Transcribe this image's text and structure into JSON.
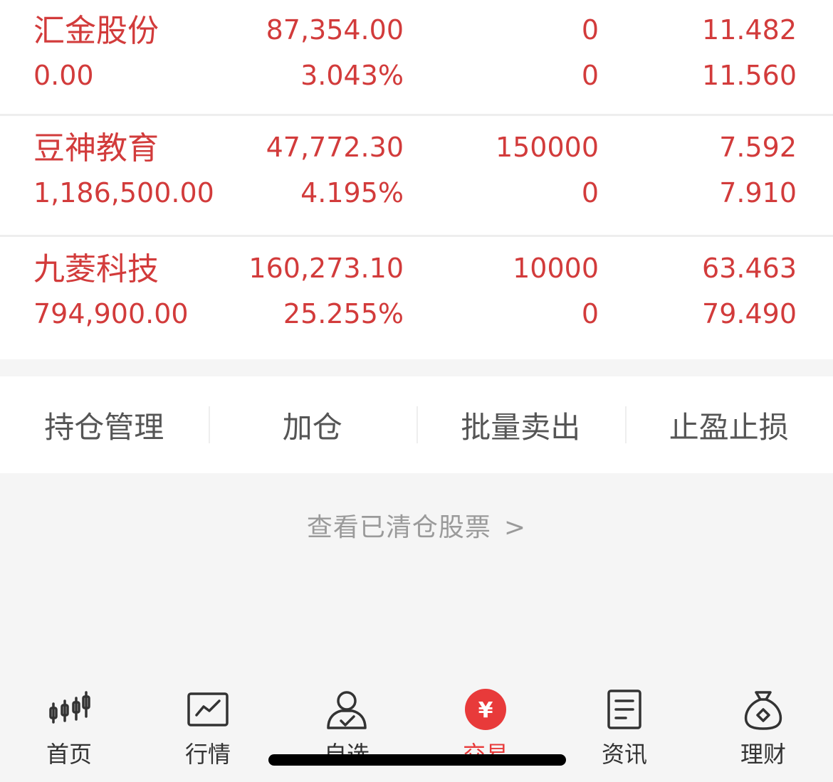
{
  "holdings": [
    {
      "name": "汇金股份",
      "market_value": "87,354.00",
      "shares": "0",
      "cost": "11.482",
      "profit_loss": "0.00",
      "ratio": "3.043%",
      "available": "0",
      "price": "11.560"
    },
    {
      "name": "豆神教育",
      "market_value": "47,772.30",
      "shares": "150000",
      "cost": "7.592",
      "profit_loss": "1,186,500.00",
      "ratio": "4.195%",
      "available": "0",
      "price": "7.910"
    },
    {
      "name": "九菱科技",
      "market_value": "160,273.10",
      "shares": "10000",
      "cost": "63.463",
      "profit_loss": "794,900.00",
      "ratio": "25.255%",
      "available": "0",
      "price": "79.490"
    }
  ],
  "actions": [
    "持仓管理",
    "加仓",
    "批量卖出",
    "止盈止损"
  ],
  "cleared_link": {
    "label": "查看已清仓股票",
    "arrow": ">"
  },
  "tabbar": [
    {
      "label": "首页",
      "icon": "candlestick-icon"
    },
    {
      "label": "行情",
      "icon": "chart-line-icon"
    },
    {
      "label": "自选",
      "icon": "user-check-icon"
    },
    {
      "label": "交易",
      "icon": "yuan-icon",
      "active": true
    },
    {
      "label": "资讯",
      "icon": "document-icon"
    },
    {
      "label": "理财",
      "icon": "money-bag-icon"
    }
  ],
  "colors": {
    "accent": "#e83a3a",
    "value_red": "#d23b3b"
  }
}
